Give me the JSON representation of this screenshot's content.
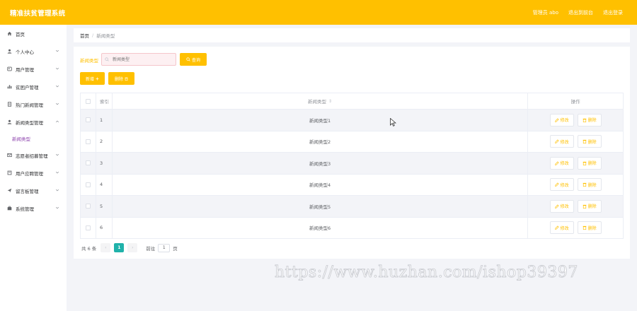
{
  "app": {
    "title": "精准扶贫管理系统",
    "top_links": [
      "管理员 abo",
      "退出到前台",
      "退出登录"
    ]
  },
  "colors": {
    "accent": "#ffc000",
    "page_active": "#20b2aa",
    "submenu_active": "#8e44ad"
  },
  "sidebar": {
    "items": [
      {
        "label": "首页",
        "icon": "home-icon",
        "has_chevron": false
      },
      {
        "label": "个人中心",
        "icon": "user-icon",
        "has_chevron": true
      },
      {
        "label": "用户管理",
        "icon": "users-icon",
        "has_chevron": true
      },
      {
        "label": "贫困户管理",
        "icon": "bar-chart-icon",
        "has_chevron": true
      },
      {
        "label": "热门新闻管理",
        "icon": "document-icon",
        "has_chevron": true
      },
      {
        "label": "新闻类型管理",
        "icon": "user-icon",
        "has_chevron": true,
        "expanded": true
      },
      {
        "label": "志愿者招募管理",
        "icon": "mail-icon",
        "has_chevron": true
      },
      {
        "label": "用户应聘管理",
        "icon": "document-icon",
        "has_chevron": true
      },
      {
        "label": "留言板管理",
        "icon": "send-icon",
        "has_chevron": true
      },
      {
        "label": "系统管理",
        "icon": "briefcase-icon",
        "has_chevron": true
      }
    ],
    "submenu": {
      "label": "新闻类型"
    }
  },
  "breadcrumb": {
    "home": "首页",
    "separator": "/",
    "current": "新闻类型"
  },
  "search": {
    "label": "新闻类型",
    "placeholder": "新闻类型",
    "button": "查询"
  },
  "actions": {
    "add": "新增",
    "delete": "删除"
  },
  "table": {
    "headers": {
      "index": "索引",
      "type": "新闻类型",
      "ops": "操作"
    },
    "rows": [
      {
        "index": "1",
        "type": "新闻类型1"
      },
      {
        "index": "2",
        "type": "新闻类型2"
      },
      {
        "index": "3",
        "type": "新闻类型3"
      },
      {
        "index": "4",
        "type": "新闻类型4"
      },
      {
        "index": "5",
        "type": "新闻类型5"
      },
      {
        "index": "6",
        "type": "新闻类型6"
      }
    ],
    "row_ops": {
      "edit": "修改",
      "delete": "删除"
    }
  },
  "pagination": {
    "total": "共 6 条",
    "current_page": "1",
    "goto_label": "前往",
    "goto_value": "1",
    "goto_suffix": "页"
  },
  "watermark": "https://www.huzhan.com/ishop39397"
}
